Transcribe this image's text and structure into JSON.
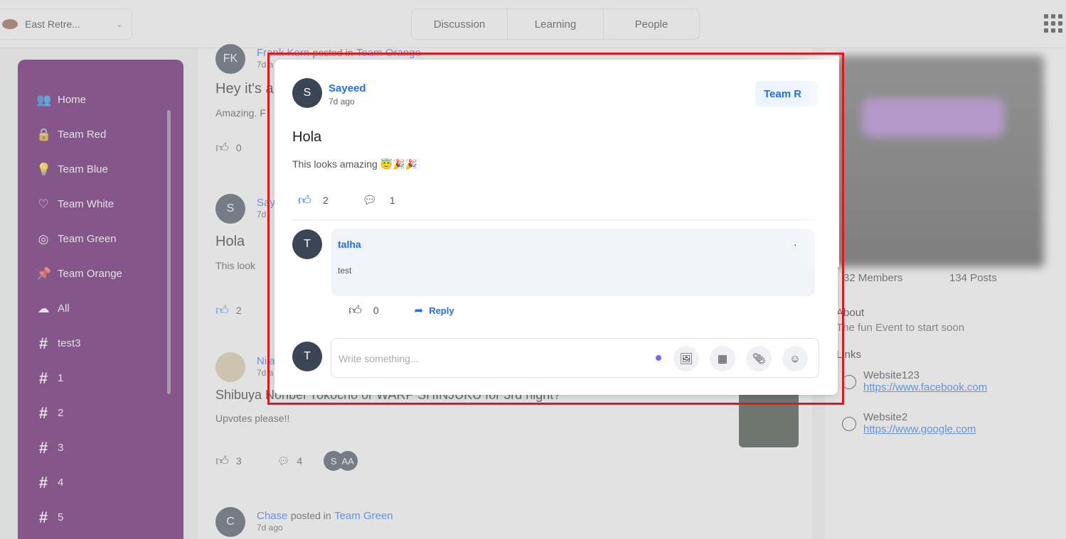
{
  "header": {
    "community": "East Retre...",
    "tabs": [
      "Discussion",
      "Learning",
      "People"
    ]
  },
  "sidebar": {
    "items": [
      {
        "icon": "users-icon",
        "label": "Home"
      },
      {
        "icon": "lock-icon",
        "label": "Team Red"
      },
      {
        "icon": "bulb-icon",
        "label": "Team Blue"
      },
      {
        "icon": "heart-icon",
        "label": "Team White"
      },
      {
        "icon": "compass-icon",
        "label": "Team Green"
      },
      {
        "icon": "pin-icon",
        "label": "Team Orange"
      },
      {
        "icon": "cloud-icon",
        "label": "All"
      },
      {
        "icon": "hash-icon",
        "label": "test3"
      },
      {
        "icon": "hash-icon",
        "label": "1"
      },
      {
        "icon": "hash-icon",
        "label": "2"
      },
      {
        "icon": "hash-icon",
        "label": "3"
      },
      {
        "icon": "hash-icon",
        "label": "4"
      },
      {
        "icon": "hash-icon",
        "label": "5"
      }
    ]
  },
  "feed": {
    "post1": {
      "initials": "FK",
      "author": "Frank Kern",
      "posted_in": "posted in",
      "team": "Team Orange",
      "time": "7d a",
      "title": "Hey it's a",
      "body": "Amazing. F",
      "likes": "0"
    },
    "post2": {
      "initials": "S",
      "author": "Say",
      "time": "7d",
      "title": "Hola",
      "body": "This look",
      "likes": "2"
    },
    "post3": {
      "author": "Nila",
      "time": "7d a",
      "title": "Shibuya Nonbei Yokocho or WARP SHINJUKU for 3rd night?",
      "body": "Upvotes please!!",
      "likes": "3",
      "comments": "4",
      "av1": "S",
      "av2": "AA"
    },
    "post4": {
      "initials": "C",
      "author": "Chase",
      "posted_in": "posted in",
      "team": "Team Green",
      "time": "7d ago"
    }
  },
  "right": {
    "members": "32 Members",
    "posts": "134 Posts",
    "about_heading": "About",
    "about_text": "The fun Event to start soon",
    "links_heading": "Links",
    "links": [
      {
        "label": "Website123",
        "url": "https://www.facebook.com"
      },
      {
        "label": "Website2",
        "url": "https://www.google.com"
      }
    ]
  },
  "modal": {
    "avatar": "S",
    "author": "Sayeed",
    "time": "7d ago",
    "team_tag": "Team R",
    "title": "Hola",
    "body": "This looks amazing 😇🎉🎉",
    "likes": "2",
    "comments": "1",
    "comment": {
      "avatar": "T",
      "author": "talha",
      "text": "test",
      "likes": "0",
      "reply_label": "Reply",
      "menu": "·"
    },
    "composer": {
      "avatar": "T",
      "placeholder": "Write something..."
    }
  },
  "colors": {
    "sidebar": "#55005d",
    "link": "#1f6feb",
    "highlight": "#e3161b"
  }
}
